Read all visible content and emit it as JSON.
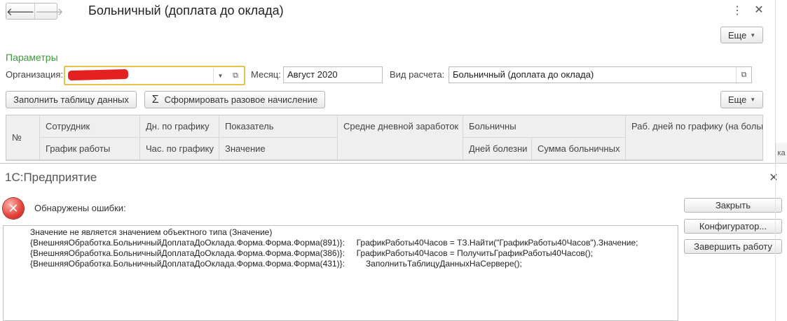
{
  "form": {
    "title": "Больничный (доплата до оклада)",
    "nav": {
      "back": "🡐",
      "forward": "🡒"
    },
    "menu_icon": "⋮",
    "close_icon": "✕",
    "more_label": "Еще",
    "section_title": "Параметры",
    "org": {
      "label": "Организация:",
      "value": ""
    },
    "month": {
      "label": "Месяц:",
      "value": "Август 2020"
    },
    "calc_type": {
      "label": "Вид расчета:",
      "value": "Больничный (доплата до оклада)"
    },
    "buttons": {
      "fill": "Заполнить таблицу данных",
      "create": "Сформировать разовое начисление",
      "more": "Еще"
    },
    "table": {
      "num": "№",
      "employee": "Сотрудник",
      "schedule": "График работы",
      "days_sched": "Дн. по графику",
      "hours_sched": "Час. по графику",
      "indicator": "Показатель",
      "value": "Значение",
      "avg_daily": "Средне дневной заработок",
      "sick": "Больничны",
      "sick_days": "Дней болезни",
      "sick_sum": "Сумма больничных",
      "work_days": "Раб. дней по графику (на больн"
    }
  },
  "dialog": {
    "title": "1С:Предприятие",
    "close_icon": "✕",
    "heading": "Обнаружены ошибки:",
    "error_icon": "✕",
    "lines": [
      "Значение не является значением объектного типа (Значение)",
      "{ВнешняяОбработка.БольничныйДоплатаДоОклада.Форма.Форма.Форма(891)}:     ГрафикРаботы40Часов = ТЗ.Найти(\"ГрафикРаботы40Часов\").Значение;",
      "{ВнешняяОбработка.БольничныйДоплатаДоОклада.Форма.Форма.Форма(386)}:     ГрафикРаботы40Часов = ПолучитьГрафикРаботы40Часов();",
      "{ВнешняяОбработка.БольничныйДоплатаДоОклада.Форма.Форма.Форма(431)}:         ЗаполнитьТаблицуДанныхНаСервере();"
    ],
    "buttons": {
      "close": "Закрыть",
      "configurator": "Конфигуратор...",
      "end": "Завершить работу"
    }
  },
  "colors": {
    "section": "#3a9a3a",
    "highlight": "#e8c24a",
    "redaction": "#e52020",
    "error": "#e2413a"
  }
}
